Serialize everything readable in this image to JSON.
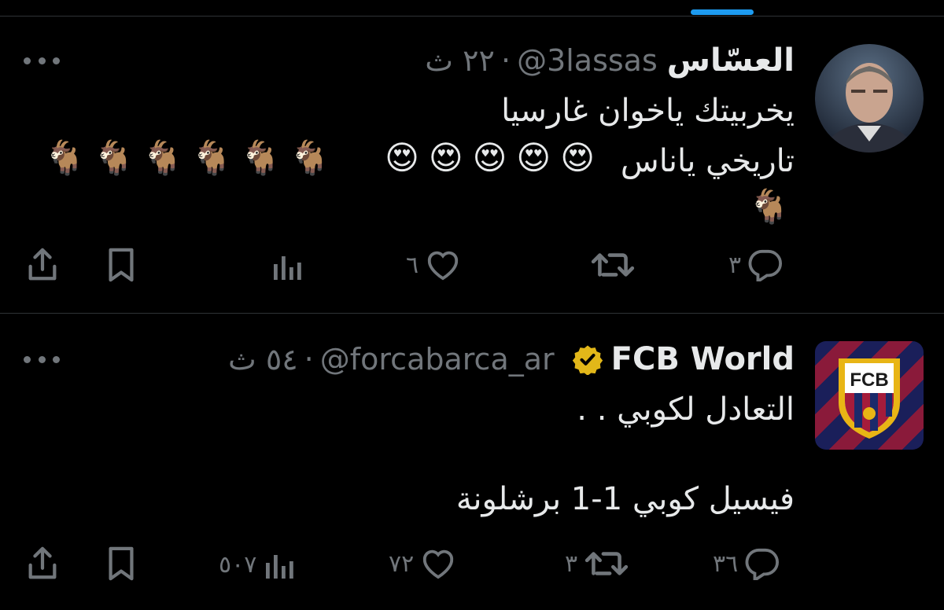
{
  "tweets": [
    {
      "author_name": "العسّاس",
      "handle": "@3lassas",
      "separator": "·",
      "time": "٢٢ ث",
      "text_lines": [
        "يخربيتك ياخوان غارسيا",
        "تاريخي ياناس"
      ],
      "hearts_eyes": "😍😍😍😍😍",
      "goats_line1": "🐐🐐🐐🐐🐐🐐",
      "goats_line2": "🐐",
      "replies": "٣",
      "retweets": "",
      "likes": "٦",
      "views": "",
      "avatar_icon": "person-photo-icon"
    },
    {
      "author_name": "FCB World",
      "handle": "@forcabarca_ar",
      "separator": "·",
      "time": "٥٤ ث",
      "verified_color": "#e2b719",
      "text_lines": [
        "التعادل لكوبي . .",
        "فيسيل كوبي 1-1 برشلونة"
      ],
      "replies": "٣٦",
      "retweets": "٣",
      "likes": "٧٢",
      "views": "٥٠٧",
      "avatar_icon": "fcb-crest-icon",
      "avatar_label": "FCB"
    }
  ],
  "colors": {
    "accent": "#1d9bf0",
    "muted": "#71767b",
    "text": "#e7e9ea",
    "divider": "#2f3336"
  }
}
